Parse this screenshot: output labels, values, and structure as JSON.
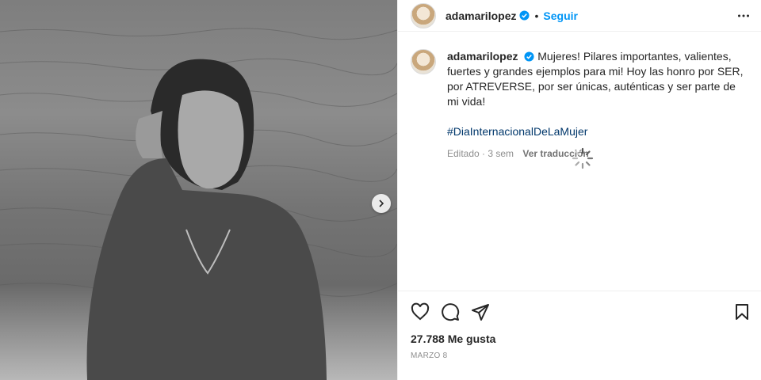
{
  "post": {
    "username": "adamarilopez",
    "follow_label": "Seguir",
    "separator": "•",
    "caption": "Mujeres! Pilares importantes, valientes, fuertes y grandes ejemplos para mi! Hoy las honro por SER, por ATREVERSE, por ser únicas, auténticas y ser parte de mi vida!",
    "hashtag": "#DiaInternacionalDeLaMujer",
    "edited_time": "Editado · 3 sem",
    "translate_label": "Ver traducción",
    "likes": "27.788 Me gusta",
    "date": "MARZO 8"
  },
  "icons": {
    "verified": "verified-badge-icon",
    "more": "more-options-icon",
    "next": "chevron-right-icon",
    "like": "heart-icon",
    "comment": "comment-icon",
    "share": "share-icon",
    "save": "bookmark-icon",
    "loading": "spinner-icon"
  },
  "colors": {
    "accent": "#0095f6",
    "hashtag": "#00376b",
    "secondary_text": "#8e8e8e",
    "verified": "#0095f6"
  }
}
